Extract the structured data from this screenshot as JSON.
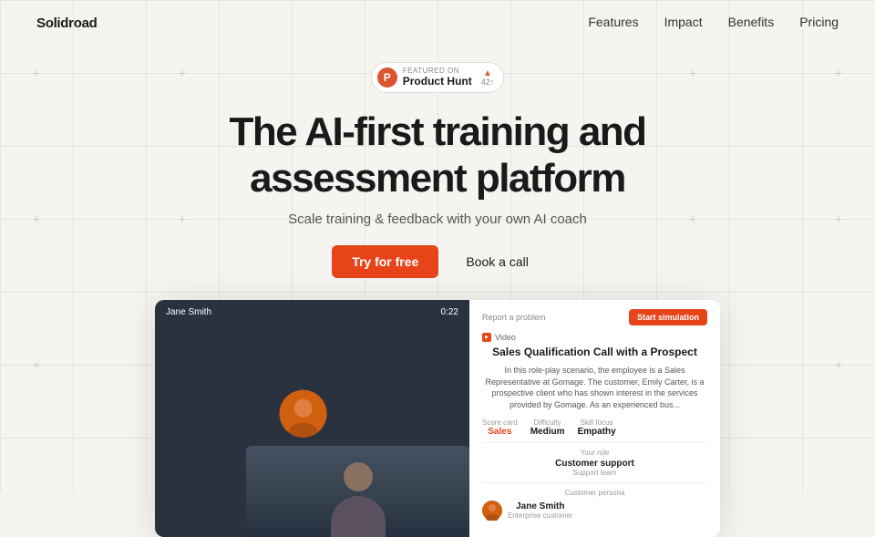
{
  "nav": {
    "logo": "Solidroad",
    "links": [
      {
        "label": "Features",
        "href": "#"
      },
      {
        "label": "Impact",
        "href": "#"
      },
      {
        "label": "Benefits",
        "href": "#"
      },
      {
        "label": "Pricing",
        "href": "#"
      }
    ]
  },
  "badge": {
    "featured_on": "FEATURED ON",
    "name": "Product Hunt",
    "arrow": "▲",
    "score": "42 ↑"
  },
  "hero": {
    "headline_line1": "The AI-first training and",
    "headline_line2": "assessment platform",
    "subheadline": "Scale training & feedback with your own AI coach",
    "cta_primary": "Try for free",
    "cta_secondary": "Book a call"
  },
  "dashboard": {
    "participant_name": "Jane Smith",
    "timer": "0:22",
    "report_link": "Report a problem",
    "start_btn": "Start simulation",
    "video_label": "Video",
    "scenario_title": "Sales Qualification Call with a Prospect",
    "scenario_desc": "In this role-play scenario, the employee is a Sales Representative at Gomage. The customer, Emily Carter, is a prospective client who has shown interest in the services provided by Gomage. As an experienced bus...",
    "score_card_label": "Score card",
    "score_card_value": "Sales",
    "difficulty_label": "Difficulty",
    "difficulty_value": "Medium",
    "skill_focus_label": "Skill focus",
    "skill_focus_value": "Empathy",
    "your_role_label": "Your role",
    "your_role_value": "Customer support",
    "your_role_sub": "Support team",
    "customer_persona_label": "Customer persona",
    "persona_name": "Jane Smith",
    "persona_role": "Enterprise customer"
  }
}
